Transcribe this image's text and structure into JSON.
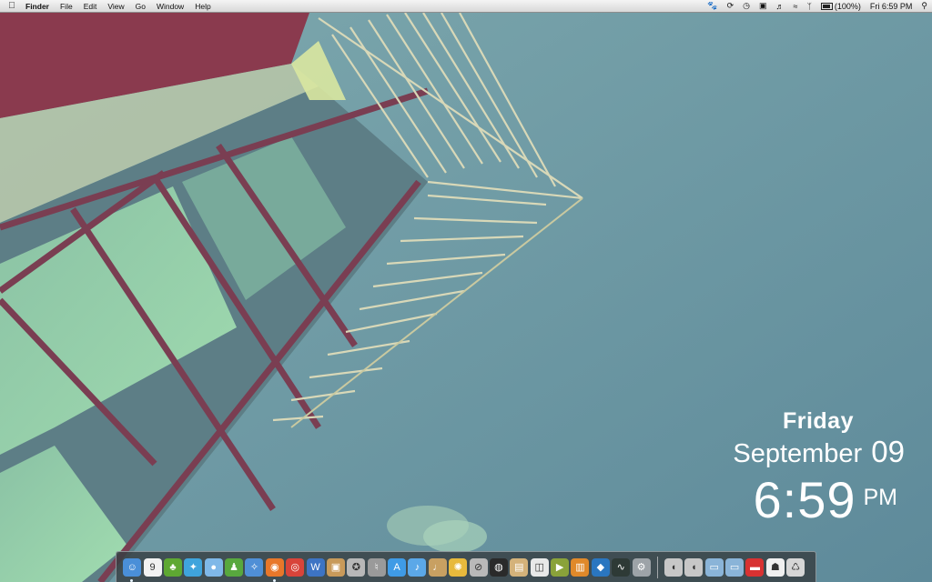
{
  "menubar": {
    "apple_icon": "apple-icon",
    "app_name": "Finder",
    "menus": [
      "File",
      "Edit",
      "View",
      "Go",
      "Window",
      "Help"
    ],
    "status_icons": [
      "paw-icon",
      "sync-icon",
      "time-machine-icon",
      "display-icon",
      "volume-icon",
      "wifi-icon",
      "bluetooth-icon"
    ],
    "battery_text": "(100%)",
    "clock_text": "Fri 6:59 PM",
    "spotlight_icon": "spotlight-search-icon"
  },
  "clock_widget": {
    "day": "Friday",
    "month": "September",
    "date_num": "09",
    "time": "6:59",
    "ampm": "PM"
  },
  "dock": {
    "apps": [
      {
        "name": "finder-icon",
        "color": "#4a8fd8",
        "glyph": "☺",
        "running": true
      },
      {
        "name": "calendar-icon",
        "color": "#f2f2f2",
        "glyph": "9",
        "running": false
      },
      {
        "name": "evernote-icon",
        "color": "#5ea832",
        "glyph": "♣",
        "running": false
      },
      {
        "name": "twitter-icon",
        "color": "#3fa4dc",
        "glyph": "✦",
        "running": false
      },
      {
        "name": "messages-icon",
        "color": "#7fb8e8",
        "glyph": "●",
        "running": false
      },
      {
        "name": "adium-icon",
        "color": "#58a83e",
        "glyph": "♟",
        "running": false
      },
      {
        "name": "safari-icon",
        "color": "#4f8fd6",
        "glyph": "✧",
        "running": false
      },
      {
        "name": "firefox-icon",
        "color": "#e8772a",
        "glyph": "◉",
        "running": true
      },
      {
        "name": "chrome-icon",
        "color": "#d8443a",
        "glyph": "◎",
        "running": false
      },
      {
        "name": "word-icon",
        "color": "#3d74c4",
        "glyph": "W",
        "running": false
      },
      {
        "name": "photos-icon",
        "color": "#c89a5a",
        "glyph": "▣",
        "running": false
      },
      {
        "name": "imovie-icon",
        "color": "#b8b8b8",
        "glyph": "✪",
        "running": false
      },
      {
        "name": "microphone-icon",
        "color": "#9a9a9a",
        "glyph": "♮",
        "running": false
      },
      {
        "name": "app-store-icon",
        "color": "#3f9be6",
        "glyph": "A",
        "running": false
      },
      {
        "name": "itunes-icon",
        "color": "#5ba8e8",
        "glyph": "♪",
        "running": false
      },
      {
        "name": "garageband-icon",
        "color": "#c8a062",
        "glyph": "♩",
        "running": false
      },
      {
        "name": "radiation-app-icon",
        "color": "#e7b93c",
        "glyph": "✺",
        "running": false
      },
      {
        "name": "blocked-icon",
        "color": "#b9b9b9",
        "glyph": "⊘",
        "running": false
      },
      {
        "name": "vinyl-record-icon",
        "color": "#2a2a2a",
        "glyph": "◍",
        "running": false
      },
      {
        "name": "preview-icon",
        "color": "#d4b27a",
        "glyph": "▤",
        "running": false
      },
      {
        "name": "white-cube-icon",
        "color": "#e8e8e8",
        "glyph": "◫",
        "running": false
      },
      {
        "name": "green-book-icon",
        "color": "#8aa23a",
        "glyph": "▶",
        "running": false
      },
      {
        "name": "orange-book-icon",
        "color": "#e0892a",
        "glyph": "▥",
        "running": false
      },
      {
        "name": "blue-cube-icon",
        "color": "#2a76c0",
        "glyph": "◆",
        "running": false
      },
      {
        "name": "activity-monitor-icon",
        "color": "#2e3a36",
        "glyph": "∿",
        "running": false
      },
      {
        "name": "system-preferences-icon",
        "color": "#9da3a8",
        "glyph": "⚙",
        "running": false
      }
    ],
    "stacks": [
      {
        "name": "applications-stack-icon",
        "color": "#c7c7c7",
        "glyph": "◖"
      },
      {
        "name": "documents-stack-icon",
        "color": "#c7c7c7",
        "glyph": "◖"
      },
      {
        "name": "folder-icon",
        "color": "#8ab4d8",
        "glyph": "▭"
      },
      {
        "name": "downloads-folder-icon",
        "color": "#8ab4d8",
        "glyph": "▭"
      },
      {
        "name": "red-bar-icon",
        "color": "#d83232",
        "glyph": "▬"
      },
      {
        "name": "stormtrooper-icon",
        "color": "#f0f0f0",
        "glyph": "☗"
      },
      {
        "name": "trash-icon",
        "color": "#d6d6d6",
        "glyph": "♺"
      }
    ]
  }
}
